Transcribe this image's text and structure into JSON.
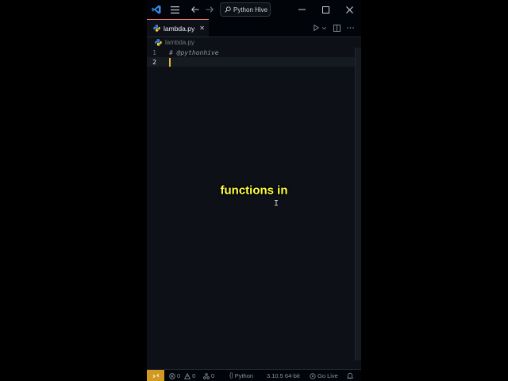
{
  "titlebar": {
    "search_text": "Python Hive"
  },
  "tabs": [
    {
      "label": "lambda.py",
      "close": "✕",
      "active": true
    }
  ],
  "breadcrumb": {
    "file": "lambda.py"
  },
  "editor": {
    "lines": [
      {
        "number": "1",
        "text": "# @pythonhive"
      },
      {
        "number": "2",
        "text": ""
      }
    ],
    "cursor_line": 2
  },
  "statusbar": {
    "errors": "0",
    "warnings": "0",
    "ports": "0",
    "language": "Python",
    "interpreter": "3.10.5 64-bit",
    "golive": "Go Live"
  },
  "caption": "functions in",
  "colors": {
    "accent_tab": "#f78166",
    "remote_badge": "#d29922",
    "caption_text": "#ffff44",
    "vscode_blue": "#3b8eea"
  }
}
